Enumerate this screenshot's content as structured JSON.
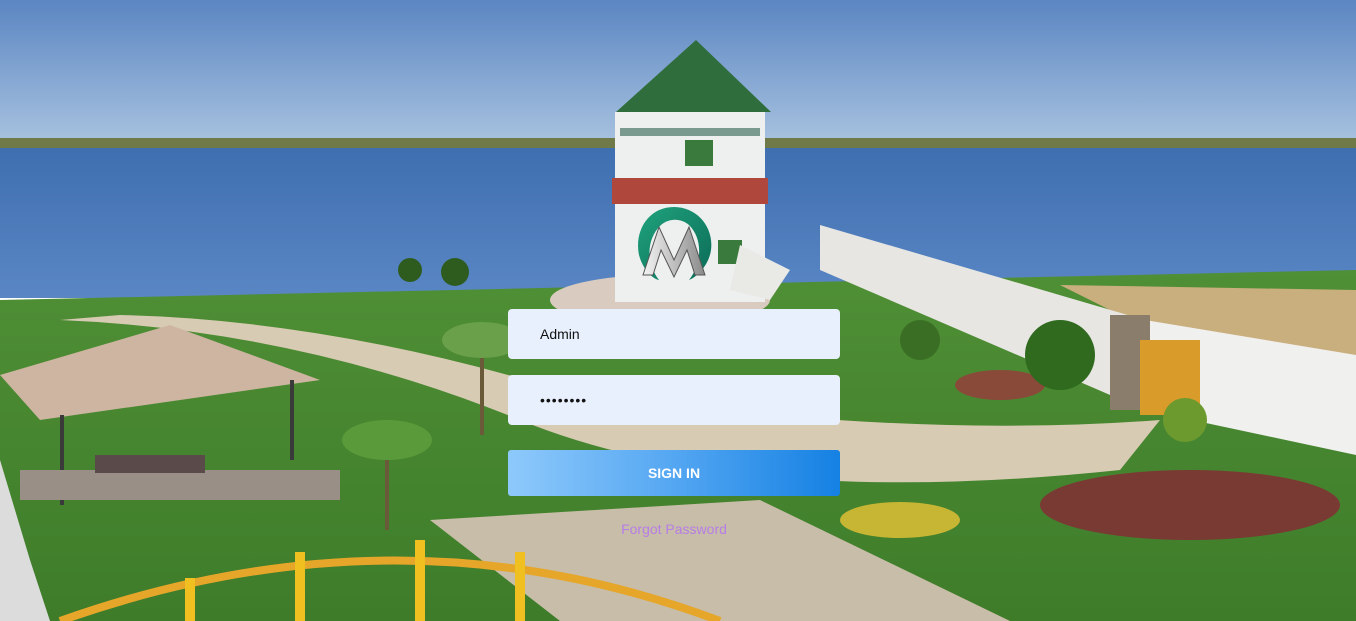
{
  "login": {
    "username_value": "Admin",
    "password_value": "••••••••",
    "sign_in_label": "SIGN IN",
    "forgot_password_label": "Forgot Password"
  },
  "icons": {
    "logo": "brand-logo",
    "background": "resort-lighthouse-scene"
  },
  "colors": {
    "button_start": "#8ec9fb",
    "button_end": "#1581e3",
    "field_bg": "#e8f0fe",
    "link": "#b67ee6"
  }
}
